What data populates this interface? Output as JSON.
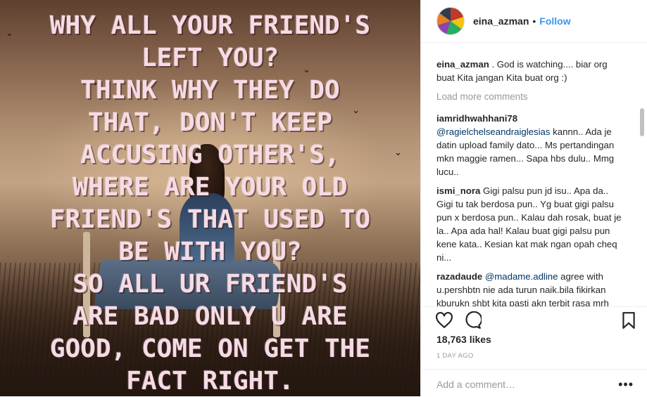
{
  "post": {
    "quote_lines": [
      "WHY ALL YOUR FRIEND'S",
      "LEFT YOU?",
      "THINK WHY THEY DO",
      "THAT, DON'T KEEP",
      "ACCUSING  OTHER'S,",
      "WHERE ARE YOUR OLD",
      "FRIEND'S THAT USED TO",
      "BE WITH YOU?",
      "SO ALL UR FRIEND'S",
      "ARE BAD ONLY U ARE",
      "GOOD, COME ON GET THE",
      "FACT RIGHT."
    ]
  },
  "header": {
    "username": "eina_azman",
    "separator": "•",
    "follow_label": "Follow"
  },
  "caption": {
    "username": "eina_azman",
    "text": " . God is watching.... biar org buat Kita jangan Kita buat org :)"
  },
  "load_more_label": "Load more comments",
  "comments": [
    {
      "username": "iamridhwahhani78",
      "mention": "@ragielchelseandraiglesias",
      "text": " kannn.. Ada je datin upload family dato... Ms pertandingan mkn maggie ramen... Sapa hbs dulu.. Mmg lucu.."
    },
    {
      "username": "ismi_nora",
      "mention": "",
      "text": " Gigi palsu pun jd isu.. Apa da.. Gigi tu tak berdosa pun.. Yg buat gigi palsu pun x berdosa pun.. Kalau dah rosak, buat je la.. Apa ada hal! Kalau buat gigi palsu pun kene kata.. Kesian kat mak ngan opah cheq ni..."
    },
    {
      "username": "razadaude",
      "mention": "@madame.adline",
      "text": " agree with u.pershbtn nie ada turun naik.bila fikirkan kburukn shbt kita pasti akn terbit rasa mrh cuba fikirkan kbaikanya.jgn ptskn siltrahim."
    }
  ],
  "stats": {
    "likes": "18,763 likes",
    "time_ago": "1 DAY AGO"
  },
  "add_comment": {
    "placeholder": "Add a comment…",
    "more": "•••"
  },
  "icons": {
    "like": "heart-icon",
    "comment": "comment-bubble-icon",
    "save": "bookmark-icon",
    "options": "more-options-icon"
  }
}
